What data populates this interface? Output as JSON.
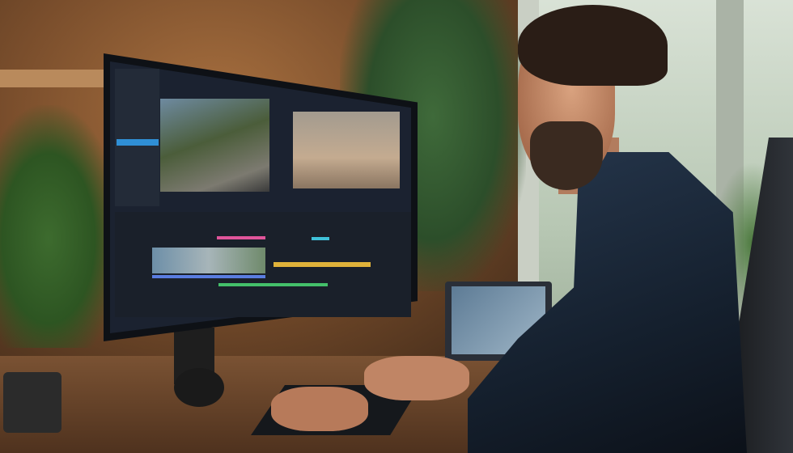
{
  "palette": {
    "wall": "#7a4e2c",
    "window": "#d9e2d6",
    "screen": "#1b2230",
    "accent_blue": "#2f8fd6",
    "shirt": "#15202e",
    "desk": "#6a4429"
  },
  "timeline_tracks": [
    {
      "color": "#e0559a"
    },
    {
      "color": "#3fc1d9"
    },
    {
      "color": "#44c06a"
    },
    {
      "color": "#e0b23a"
    },
    {
      "color": "#5a7de0"
    }
  ]
}
